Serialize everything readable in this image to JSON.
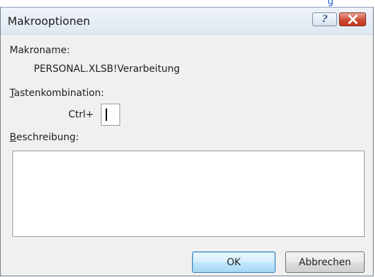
{
  "background": {
    "fragment_text": "g"
  },
  "dialog": {
    "title": "Makrooptionen",
    "help_glyph": "?",
    "macro_name_label": "Makroname:",
    "macro_name_value": "PERSONAL.XLSB!Verarbeitung",
    "shortcut_label_first": "T",
    "shortcut_label_rest": "astenkombination:",
    "ctrl_prefix": "Ctrl+",
    "shortcut_key_value": "",
    "description_label_first": "B",
    "description_label_rest": "eschreibung:",
    "description_value": "",
    "ok_label": "OK",
    "cancel_label": "Abbrechen"
  },
  "colors": {
    "dialog_bg": "#f0f0f0",
    "close_button": "#c2391f",
    "default_button_border": "#3c7fb1"
  }
}
